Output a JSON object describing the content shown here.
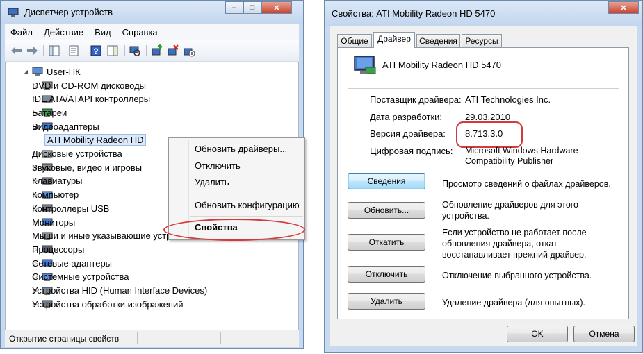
{
  "device_manager": {
    "title": "Диспетчер устройств",
    "menu": [
      "Файл",
      "Действие",
      "Вид",
      "Справка"
    ],
    "toolbar_icons": [
      "back-arrow-icon",
      "forward-arrow-icon",
      "console-tree-icon",
      "properties-icon",
      "help-icon",
      "action-pane-icon",
      "scan-hardware-icon",
      "update-driver-icon",
      "uninstall-icon",
      "disable-icon"
    ],
    "tree": {
      "root": "User-ПК",
      "items": [
        {
          "label": "DVD и CD-ROM дисководы",
          "icon": "dvd-drive-icon"
        },
        {
          "label": "IDE ATA/ATAPI контроллеры",
          "icon": "ide-controller-icon"
        },
        {
          "label": "Батареи",
          "icon": "battery-icon"
        },
        {
          "label": "Видеоадаптеры",
          "icon": "display-adapter-icon",
          "expanded": true
        },
        {
          "label": "ATI Mobility Radeon HD",
          "icon": "display-adapter-icon",
          "child": true,
          "selected": true
        },
        {
          "label": "Дисковые устройства",
          "icon": "disk-drive-icon"
        },
        {
          "label": "Звуковые, видео и игровы",
          "icon": "sound-icon"
        },
        {
          "label": "Клавиатуры",
          "icon": "keyboard-icon"
        },
        {
          "label": "Компьютер",
          "icon": "computer-icon"
        },
        {
          "label": "Контроллеры USB",
          "icon": "usb-icon"
        },
        {
          "label": "Мониторы",
          "icon": "monitor-icon"
        },
        {
          "label": "Мыши и иные указывающие устройства",
          "icon": "mouse-icon"
        },
        {
          "label": "Процессоры",
          "icon": "processor-icon"
        },
        {
          "label": "Сетевые адаптеры",
          "icon": "network-adapter-icon"
        },
        {
          "label": "Системные устройства",
          "icon": "system-devices-icon"
        },
        {
          "label": "Устройства HID (Human Interface Devices)",
          "icon": "hid-icon"
        },
        {
          "label": "Устройства обработки изображений",
          "icon": "imaging-device-icon"
        }
      ]
    },
    "context_menu": {
      "items": [
        "Обновить драйверы...",
        "Отключить",
        "Удалить",
        "Обновить конфигурацию",
        "Свойства"
      ],
      "bold_item": "Свойства"
    },
    "status": "Открытие страницы свойств"
  },
  "properties_dialog": {
    "title": "Свойства: ATI Mobility Radeon HD 5470",
    "tabs": [
      "Общие",
      "Драйвер",
      "Сведения",
      "Ресурсы"
    ],
    "active_tab": "Драйвер",
    "device_name": "ATI Mobility Radeon HD 5470",
    "fields": {
      "provider_label": "Поставщик драйвера:",
      "provider_value": "ATI Technologies Inc.",
      "date_label": "Дата разработки:",
      "date_value": "29.03.2010",
      "version_label": "Версия драйвера:",
      "version_value": "8.713.3.0",
      "signature_label": "Цифровая подпись:",
      "signature_value": "Microsoft Windows Hardware Compatibility Publisher"
    },
    "buttons": [
      {
        "label": "Сведения",
        "desc": "Просмотр сведений о файлах драйверов."
      },
      {
        "label": "Обновить...",
        "desc": "Обновление драйверов для этого устройства."
      },
      {
        "label": "Откатить",
        "desc": "Если устройство не работает после обновления драйвера, откат восстанавливает прежний драйвер."
      },
      {
        "label": "Отключить",
        "desc": "Отключение выбранного устройства."
      },
      {
        "label": "Удалить",
        "desc": "Удаление драйвера (для опытных)."
      }
    ],
    "ok_label": "OK",
    "cancel_label": "Отмена"
  },
  "colors": {
    "highlight_oval": "#d6393a",
    "window_frame": "#c8daf0",
    "selection": "#dbe9fb"
  }
}
